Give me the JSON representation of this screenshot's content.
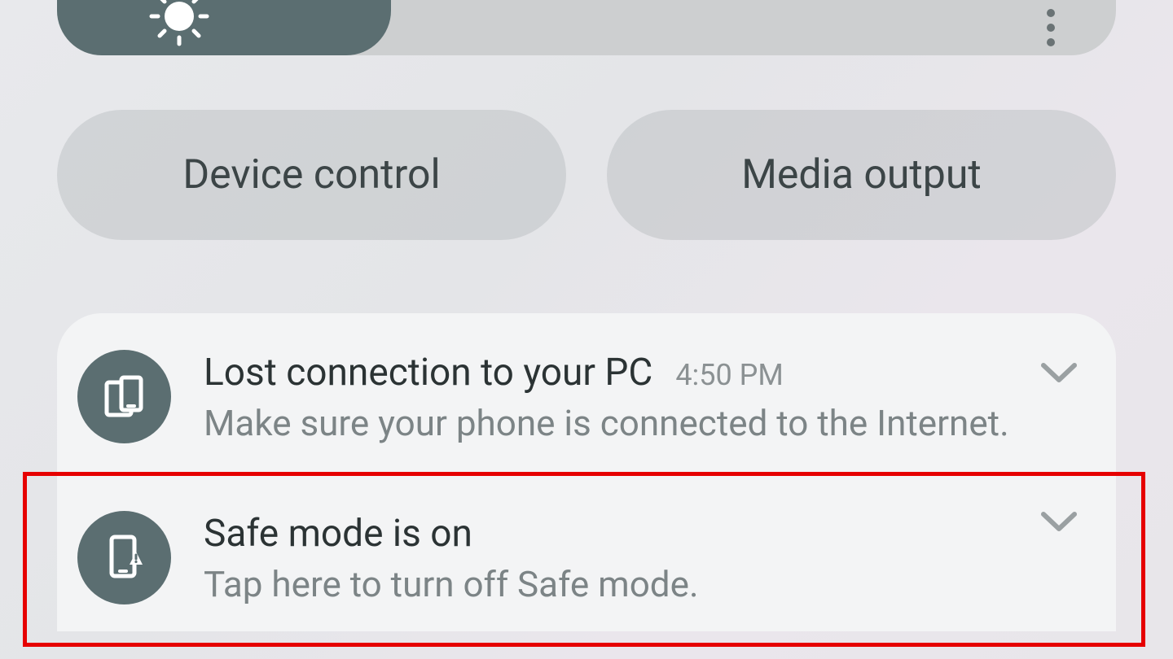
{
  "brightness": {
    "fill_percent": 31
  },
  "quick_panel": {
    "device_control_label": "Device control",
    "media_output_label": "Media output"
  },
  "notifications": [
    {
      "title": "Lost connection to your PC",
      "time": "4:50 PM",
      "description": "Make sure your phone is connected to the Internet."
    },
    {
      "title": "Safe mode is on",
      "time": "",
      "description": "Tap here to turn off Safe mode."
    }
  ],
  "colors": {
    "accent": "#5b6e71",
    "highlight": "#e60000"
  }
}
